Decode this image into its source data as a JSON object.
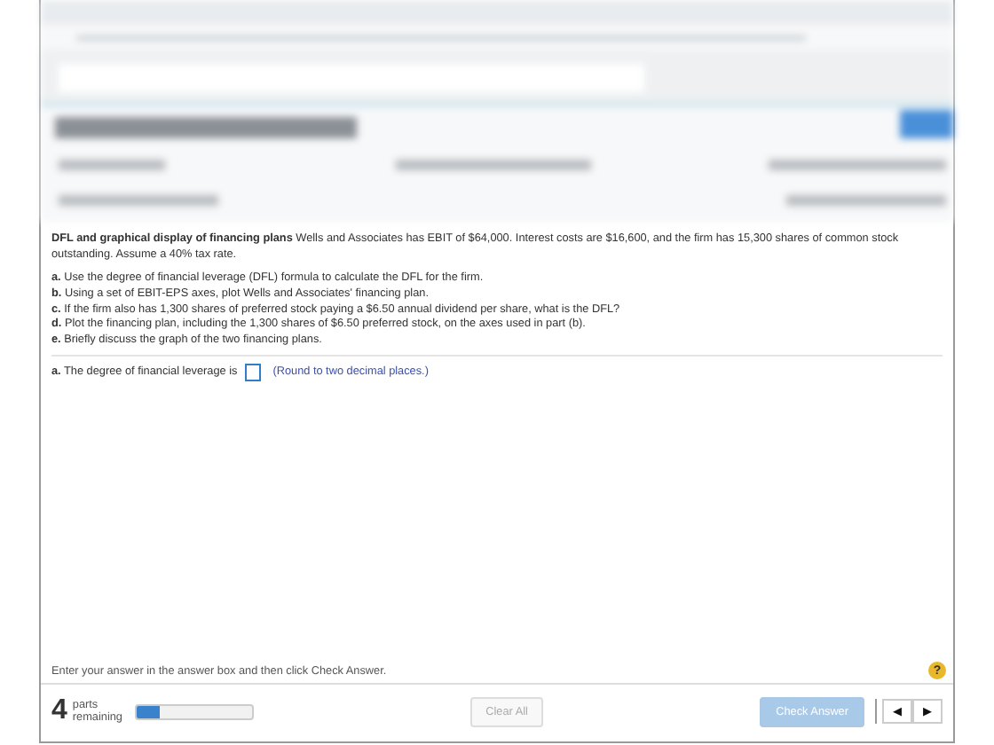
{
  "problem": {
    "title": "DFL and graphical display of financing plans",
    "intro": "Wells and Associates has EBIT of $64,000. Interest costs are $16,600, and the firm has 15,300 shares of common stock outstanding. Assume a 40% tax rate.",
    "parts": [
      {
        "letter": "a.",
        "text": "Use the degree of financial leverage (DFL) formula to calculate the DFL for the firm."
      },
      {
        "letter": "b.",
        "text": "Using a set of EBIT-EPS axes, plot Wells and Associates' financing plan."
      },
      {
        "letter": "c.",
        "text": "If the firm also has 1,300 shares of preferred stock paying a $6.50 annual dividend per share, what is the DFL?"
      },
      {
        "letter": "d.",
        "text": "Plot the financing plan, including the 1,300 shares of $6.50 preferred stock, on the axes used in part (b)."
      },
      {
        "letter": "e.",
        "text": "Briefly discuss the graph of the two financing plans."
      }
    ],
    "answer": {
      "letter": "a.",
      "prompt": "The degree of financial leverage is",
      "hint": "(Round to two decimal places.)"
    }
  },
  "instruction": "Enter your answer in the answer box and then click Check Answer.",
  "help_symbol": "?",
  "footer": {
    "parts_count": "4",
    "parts_label": "parts remaining",
    "progress": {
      "level": 0.2
    },
    "clear_button": {
      "label": "Clear All",
      "disabled": true
    },
    "check_button": {
      "label": "Check Answer",
      "disabled": true
    },
    "prev_symbol": "◀",
    "next_symbol": "▶"
  }
}
